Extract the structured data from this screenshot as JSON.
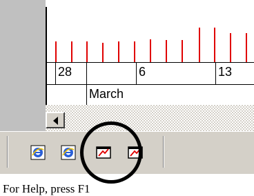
{
  "timeline": {
    "dates": [
      "28",
      "6",
      "13"
    ],
    "month": "March",
    "tick_color": "#e00000"
  },
  "scrollbar": {
    "left_arrow_icon": "left-arrow-icon"
  },
  "taskbar": {
    "icons": [
      "ie-browser-icon",
      "ie-browser-icon-alt",
      "chart-window-icon",
      "chart-window-icon-alt"
    ]
  },
  "status": {
    "text": "For Help, press F1"
  },
  "annotation": {
    "color": "#000000"
  }
}
